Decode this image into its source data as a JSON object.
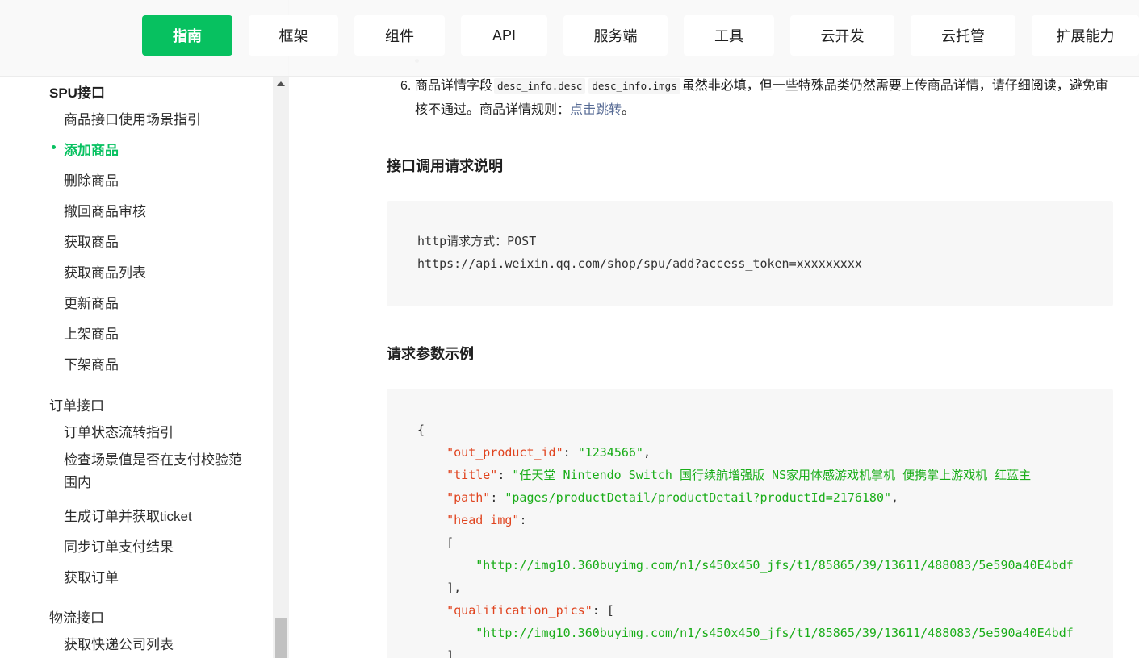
{
  "nav": {
    "tabs": [
      {
        "label": "指南",
        "active": true
      },
      {
        "label": "框架"
      },
      {
        "label": "组件"
      },
      {
        "label": "API"
      },
      {
        "label": "服务端"
      },
      {
        "label": "工具"
      },
      {
        "label": "云开发"
      },
      {
        "label": "云托管"
      },
      {
        "label": "扩展能力"
      }
    ]
  },
  "sidebar": {
    "groups": [
      {
        "title": "SPU接口",
        "items": [
          "商品接口使用场景指引",
          "添加商品",
          "删除商品",
          "撤回商品审核",
          "获取商品",
          "获取商品列表",
          "更新商品",
          "上架商品",
          "下架商品"
        ]
      },
      {
        "title": "订单接口",
        "items": [
          "订单状态流转指引",
          "检查场景值是否在支付校验范围内",
          "生成订单并获取ticket",
          "同步订单支付结果",
          "获取订单"
        ]
      },
      {
        "title": "物流接口",
        "items": [
          "获取快递公司列表"
        ]
      }
    ],
    "active_item": "添加商品"
  },
  "content": {
    "list_item_6": {
      "number": "6.",
      "text_before": "商品详情字段",
      "code1": "desc_info.desc",
      "code2": "desc_info.imgs",
      "text_after": "虽然非必填，但一些特殊品类仍然需要上传商品详情，请仔细阅读，避免审核不通过。商品详情规则：",
      "link": "点击跳转",
      "end": "。"
    },
    "section_request_title": "接口调用请求说明",
    "request_lines": [
      "http请求方式：POST",
      "https://api.weixin.qq.com/shop/spu/add?access_token=xxxxxxxxx"
    ],
    "section_example_title": "请求参数示例",
    "example": {
      "open_brace": "{",
      "out_product_id_key": "\"out_product_id\"",
      "out_product_id_val": "\"1234566\"",
      "title_key": "\"title\"",
      "title_val": "\"任天堂 Nintendo Switch 国行续航增强版 NS家用体感游戏机掌机 便携掌上游戏机 红蓝主",
      "path_key": "\"path\"",
      "path_val": "\"pages/productDetail/productDetail?productId=2176180\"",
      "head_img_key": "\"head_img\"",
      "open_bracket": "[",
      "head_img_url": "\"http://img10.360buyimg.com/n1/s450x450_jfs/t1/85865/39/13611/488083/5e590a40E4bdf",
      "close_bracket_comma": "],",
      "qualification_pics_key": "\"qualification_pics\"",
      "qualification_pics_url": "\"http://img10.360buyimg.com/n1/s450x450_jfs/t1/85865/39/13611/488083/5e590a40E4bdf",
      "close_bracket": "]"
    }
  },
  "colors": {
    "accent": "#07c160",
    "json_key": "#e0441f",
    "json_string": "#1aad19",
    "link": "#576b95"
  }
}
